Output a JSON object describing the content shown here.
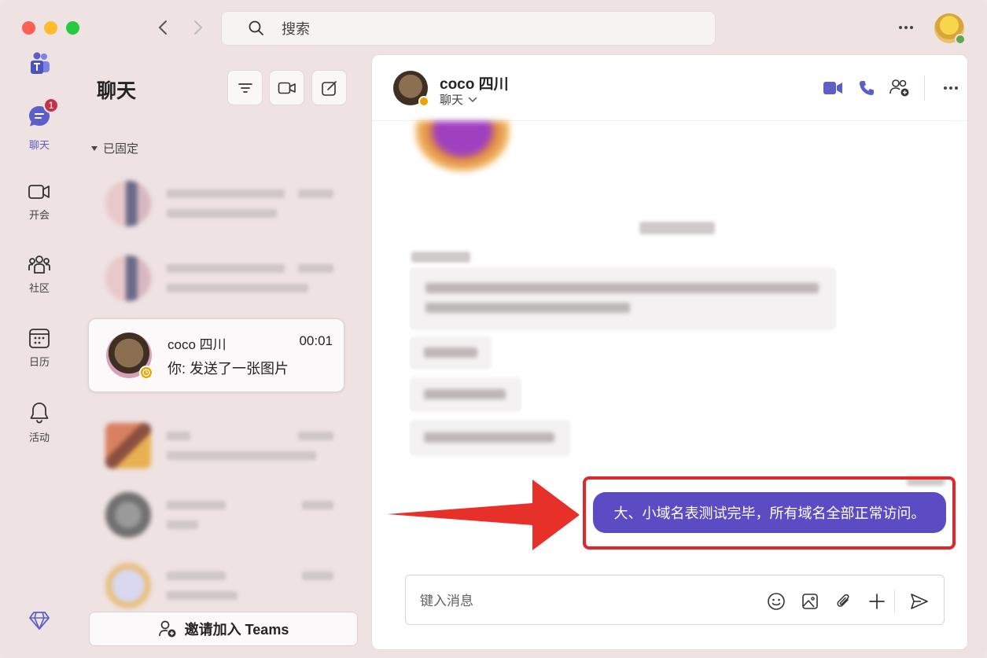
{
  "window": {
    "search_placeholder": "搜索"
  },
  "rail": {
    "chat": {
      "label": "聊天",
      "badge": "1"
    },
    "meet": {
      "label": "开会"
    },
    "community": {
      "label": "社区"
    },
    "calendar": {
      "label": "日历"
    },
    "activity": {
      "label": "活动"
    }
  },
  "list": {
    "title": "聊天",
    "pinned_label": "已固定",
    "selected_chat": {
      "name": "coco 四川",
      "time": "00:01",
      "preview": "你: 发送了一张图片"
    },
    "invite_label": "邀请加入 Teams"
  },
  "conversation": {
    "contact_name": "coco 四川",
    "subtitle": "聊天",
    "sent_message": "大、小域名表测试完毕，所有域名全部正常访问。",
    "composer_placeholder": "键入消息"
  },
  "colors": {
    "accent": "#5b5fc7",
    "sent_bubble": "#5b4cc4",
    "highlight": "#e0282a",
    "badge": "#c4314b"
  }
}
